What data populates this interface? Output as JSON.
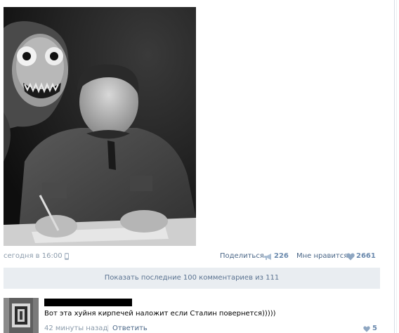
{
  "post": {
    "date": "сегодня в 16:00",
    "share_label": "Поделиться",
    "share_count": "226",
    "like_label": "Мне нравится",
    "like_count": "2661"
  },
  "comments_bar": {
    "label": "Показать последние 100 комментариев из 111"
  },
  "comment": {
    "text": "Вот эта хуйня кирпечей наложит если Сталин повернется)))))",
    "time": "42 минуты назад",
    "separator": "|",
    "reply_label": "Ответить",
    "likes": "5"
  },
  "icons": {
    "phone": "phone-icon",
    "share": "megaphone-icon",
    "like": "heart-icon"
  },
  "colors": {
    "link": "#4a6687",
    "muted": "#8b9bab",
    "count": "#6a89ad",
    "bar_bg": "#e9edf1"
  }
}
